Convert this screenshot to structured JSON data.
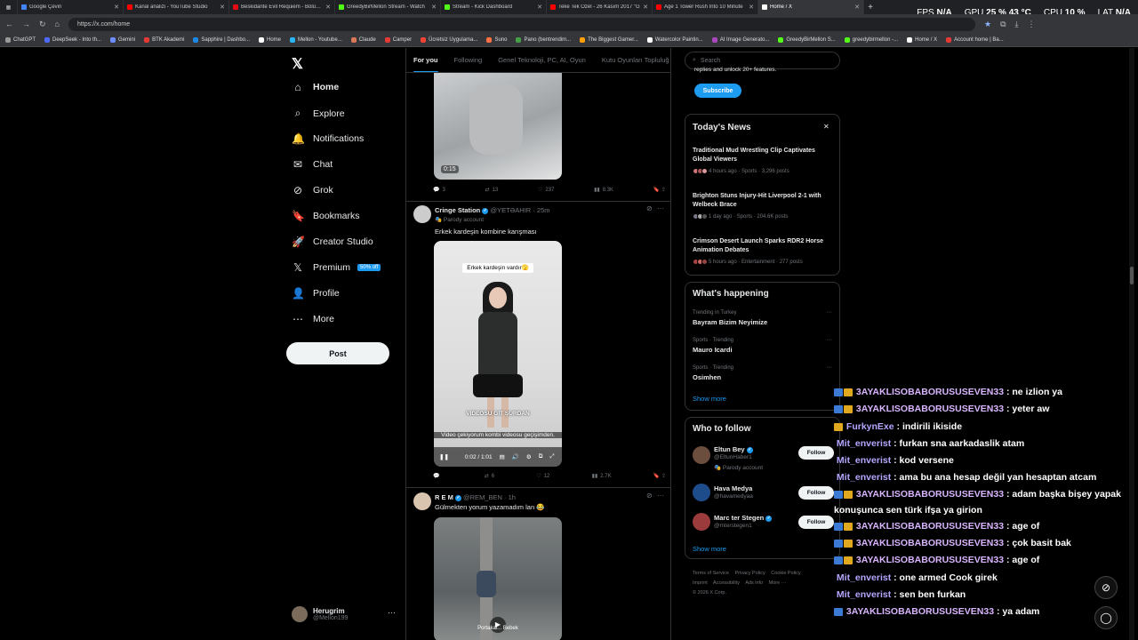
{
  "browser": {
    "tabs": [
      {
        "title": "Google Çeviri",
        "color": "#4285f4"
      },
      {
        "title": "Kanal analizi - YouTube Studio",
        "color": "#ff0000"
      },
      {
        "title": "Beskidante Evil Requiem - Bölüm 4",
        "color": "#e50914"
      },
      {
        "title": "GreedyBirMellon Stream - Watch",
        "color": "#53fc18"
      },
      {
        "title": "Stream - Kick Dashboard",
        "color": "#53fc18"
      },
      {
        "title": "Teke Tek Özel - 26 Kasım 2017 \"G",
        "color": "#ff0000"
      },
      {
        "title": "Age 1 Tower Rush Into 10 Minute",
        "color": "#ff0000"
      },
      {
        "title": "Home / X",
        "color": "#ffffff"
      }
    ],
    "new_tab": "+",
    "url": "https://x.com/home",
    "perf": {
      "fps_label": "FPS",
      "fps": "N/A",
      "gpu_label": "GPU",
      "gpu": "25 % 43 °C",
      "cpu_label": "CPU",
      "cpu": "10 %",
      "lat_label": "LAT",
      "lat": "N/A"
    },
    "bookmarks": [
      "ChatGPT",
      "DeepSeek - Into th...",
      "Gemini",
      "BTK Akademi",
      "Sapphire | Dashbo...",
      "Home",
      "Mellon - Youtube...",
      "Claude",
      "Camper",
      "Ücretsiz Uygulama...",
      "Suno",
      "Pano (bentrendim...",
      "The Biggest Gamer...",
      "Watercolor Paintin...",
      "AI Image Generato...",
      "GreedyBirMellon S...",
      "greedybirmellon -...",
      "Home / X",
      "Account home | Ba..."
    ]
  },
  "nav": {
    "logo": "𝕏",
    "items": [
      {
        "icon": "⌂",
        "label": "Home"
      },
      {
        "icon": "⌕",
        "label": "Explore"
      },
      {
        "icon": "🔔",
        "label": "Notifications"
      },
      {
        "icon": "✉",
        "label": "Chat"
      },
      {
        "icon": "⊘",
        "label": "Grok"
      },
      {
        "icon": "🔖",
        "label": "Bookmarks"
      },
      {
        "icon": "🚀",
        "label": "Creator Studio"
      },
      {
        "icon": "𝕏",
        "label": "Premium"
      },
      {
        "icon": "👤",
        "label": "Profile"
      },
      {
        "icon": "⋯",
        "label": "More"
      }
    ],
    "premium_badge": "50% off",
    "post_label": "Post",
    "account": {
      "name": "Herugrim",
      "handle": "@Mellon199",
      "more": "···"
    }
  },
  "timeline": {
    "tabs": [
      "For you",
      "Following",
      "Genel Teknoloji, PC, AI, Oyun",
      "Kutu Oyunları Topluluğ"
    ],
    "tweet1": {
      "duration": "0:15",
      "replies": "3",
      "reposts": "13",
      "likes": "237",
      "views": "8.3K"
    },
    "tweet2": {
      "name": "Cringe Station",
      "handle": "@YETƏAHIR",
      "time": "· 25m",
      "parody": "Parody account",
      "text": "Erkek kardeşin kombine karışması",
      "overlay_top": "Erkek kardeşin vardır🫣",
      "overlay_mid": "VIDEOSU GIT ŞURDAN",
      "caption": "Video çekiyorum kombi videosu geçişimden.",
      "video_time": "0:02 / 1:01",
      "replies": "",
      "reposts": "6",
      "likes": "12",
      "views": "2.7K"
    },
    "tweet3": {
      "name": "R E M",
      "handle": "@REM_BEN",
      "time": "· 1h",
      "text": "Gülmekten yorum yazamadım lan 😂",
      "caption": "Portakal... Bebek"
    }
  },
  "sidebar": {
    "search_placeholder": "Search",
    "subscribe_text": "replies and unlock 20+ features.",
    "subscribe_label": "Subscribe",
    "news_title": "Today's News",
    "news_close": "✕",
    "news": [
      {
        "title": "Traditional Mud Wrestling Clip Captivates Global Viewers",
        "meta": "4 hours ago · Sports · 3,296 posts"
      },
      {
        "title": "Brighton Stuns Injury-Hit Liverpool 2-1 with Welbeck Brace",
        "meta": "1 day ago · Sports · 204.6K posts"
      },
      {
        "title": "Crimson Desert Launch Sparks RDR2 Horse Animation Debates",
        "meta": "5 hours ago · Entertainment · 277 posts"
      }
    ],
    "happening_title": "What's happening",
    "trends": [
      {
        "meta": "Trending in Turkey",
        "name": "Bayram Bizim Neyimize"
      },
      {
        "meta": "Sports · Trending",
        "name": "Mauro Icardi"
      },
      {
        "meta": "Sports · Trending",
        "name": "Osimhen"
      }
    ],
    "trends_more": "Show more",
    "follow_title": "Who to follow",
    "follow": [
      {
        "name": "Eltun Bey",
        "handle": "@EltunHaber1",
        "extra": "Parody account",
        "button": "Follow"
      },
      {
        "name": "Hava Medya",
        "handle": "@havamedyaa",
        "extra": "",
        "button": "Follow"
      },
      {
        "name": "Marc ter Stegen",
        "handle": "@mterstegen1",
        "extra": "",
        "button": "Follow"
      }
    ],
    "follow_more": "Show more",
    "footer": [
      "Terms of Service",
      "Privacy Policy",
      "Cookie Policy",
      "Imprint",
      "Accessibility",
      "Ads info",
      "More ···",
      "© 2026 X Corp."
    ]
  },
  "chat": [
    {
      "user": "3AYAKLISOBABORUSUSEVEN33",
      "msg": ": ne izlion ya"
    },
    {
      "user": "3AYAKLISOBABORUSUSEVEN33",
      "msg": ": yeter aw"
    },
    {
      "user": "FurkynExe",
      "msg": ": indirili ikiside"
    },
    {
      "user": "Mit_enverist",
      "msg": ": furkan sna aarkadaslik atam"
    },
    {
      "user": "Mit_enverist",
      "msg": ": kod versene"
    },
    {
      "user": "Mit_enverist",
      "msg": ": ama bu ana hesap değil yan hesaptan atcam"
    },
    {
      "user": "3AYAKLISOBABORUSUSEVEN33",
      "msg": ": adam başka bişey yapak"
    },
    {
      "user": "",
      "msg": "konuşunca sen türk ifşa ya girion"
    },
    {
      "user": "3AYAKLISOBABORUSUSEVEN33",
      "msg": ": age of"
    },
    {
      "user": "3AYAKLISOBABORUSUSEVEN33",
      "msg": ": çok basit bak"
    },
    {
      "user": "3AYAKLISOBABORUSUSEVEN33",
      "msg": ": age of"
    },
    {
      "user": "Mit_enverist",
      "msg": ": one armed Cook girek"
    },
    {
      "user": "Mit_enverist",
      "msg": ": sen ben furkan"
    },
    {
      "user": "3AYAKLISOBABORUSUSEVEN33",
      "msg": ": ya adam"
    }
  ]
}
